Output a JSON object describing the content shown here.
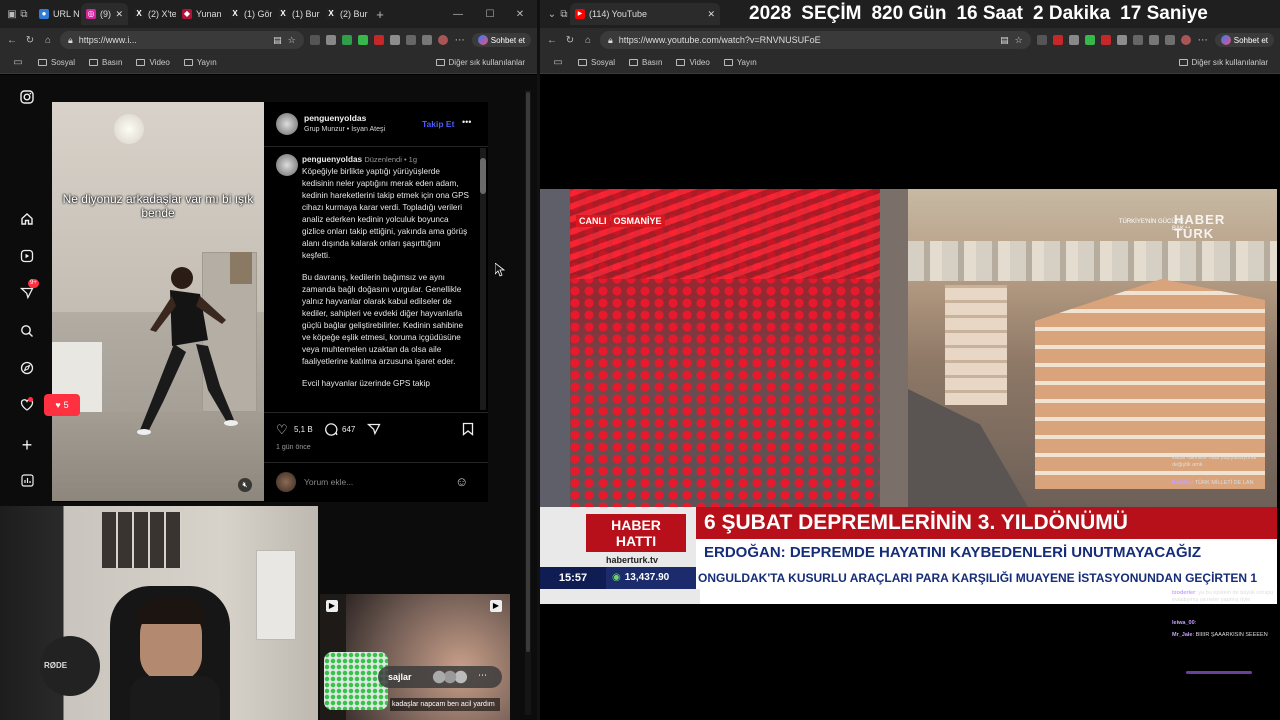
{
  "left_browser": {
    "tabs": [
      {
        "label": "URL Ni",
        "color": "#2f7bd6",
        "glyph": "●"
      },
      {
        "label": "(9)",
        "color": "#d6249f",
        "glyph": "◎"
      },
      {
        "label": "(2) X'te",
        "color": "#222222",
        "glyph": "X"
      },
      {
        "label": "Yunan",
        "color": "#b0123a",
        "glyph": "◆"
      },
      {
        "label": "(1) Gön",
        "color": "#222222",
        "glyph": "X"
      },
      {
        "label": "(1) Burı",
        "color": "#222222",
        "glyph": "X"
      },
      {
        "label": "(2) Burı",
        "color": "#222222",
        "glyph": "X"
      }
    ],
    "url": "https://www.i...",
    "copilot_label": "Sohbet et",
    "bookmarks": [
      "Sosyal",
      "Basın",
      "Video",
      "Yayın"
    ],
    "other_bookmarks": "Diğer sık kullanılanlar"
  },
  "instagram": {
    "video_overlay_text": "Ne diyonuz arkadaşlar var mı bi ışık bende",
    "username": "penguenyoldas",
    "subtitle": "Grup Munzur • İsyan Ateşi",
    "follow_label": "Takip Et",
    "more_label": "•••",
    "caption_user": "penguenyoldas",
    "caption_meta": "Düzenlendi • 1g",
    "caption_p1": "Köpeğiyle birlikte yaptığı yürüyüşlerde kedisinin neler yaptığını merak eden adam, kedinin hareketlerini takip etmek için ona GPS cihazı kurmaya karar verdi. Topladığı verileri analiz ederken kedinin yolculuk boyunca gizlice onları takip ettiğini, yakında ama görüş alanı dışında kalarak onları şaşırttığını keşfetti.",
    "caption_p2": "Bu davranış, kedilerin bağımsız ve aynı zamanda bağlı doğasını vurgular. Genellikle yalnız hayvanlar olarak kabul edilseler de kediler, sahipleri ve evdeki diğer hayvanlarla güçlü bağlar geliştirebilirler. Kedinin sahibine ve köpeğe eşlik etmesi, koruma içgüdüsüne veya muhtemelen uzaktan da olsa aile faaliyetlerine katılma arzusuna işaret eder.",
    "caption_p3": "Evcil hayvanlar üzerinde GPS takip",
    "likes": "5,1 B",
    "comments": "647",
    "time_ago": "1 gün önce",
    "comment_placeholder": "Yorum ekle...",
    "notification_count": "9+",
    "likes_badge": "5",
    "reel_text": "sajlar",
    "reel_subtitle": "kadaşlar napcam ben acil yardım"
  },
  "right_browser": {
    "tab_label": "(114) YouTube",
    "url": "https://www.youtube.com/watch?v=RNVNUSUFoE",
    "copilot_label": "Sohbet et",
    "bookmarks": [
      "Sosyal",
      "Basın",
      "Video",
      "Yayın"
    ],
    "other_bookmarks": "Diğer sık kullanılanlar"
  },
  "countdown": {
    "year": "2028",
    "label": "SEÇİM",
    "days": "820",
    "days_unit": "Gün",
    "hours": "16",
    "hours_unit": "Saat",
    "minutes": "2",
    "minutes_unit": "Dakika",
    "seconds": "17",
    "seconds_unit": "Saniye"
  },
  "broadcast": {
    "live_label": "CANLI",
    "location": "OSMANİYE",
    "channel_logo": "HABER TÜRK",
    "promo_text": "TÜRKİYE'NİN GÜCÜNE BAK",
    "ticker_brand_1": "HABER",
    "ticker_brand_2": "HATTI",
    "site": "haberturk.tv",
    "headline": "6 ŞUBAT DEPREMLERİNİN 3. YILDÖNÜMÜ",
    "subheadline": "ERDOĞAN: DEPREMDE HAYATINI KAYBEDENLERİ UNUTMAYACAĞIZ",
    "clock": "15:57",
    "index_value": "13,437.90",
    "crawl": "ONGULDAK'TA KUSURLU ARAÇLARI PARA KARŞILIĞI MUAYENE İSTASYONUNDAN GEÇİRTEN 1"
  },
  "chat_overlay": [
    {
      "user": "",
      "text": "kadar fakirlikle hala yaşıyabiliyorlar değiştik amk"
    },
    {
      "user": "Kokliliq",
      "text": "TÜRK MİLLETİ DE LAN"
    },
    {
      "user": "tzoderler",
      "text": "ya bu epstein de büyük orospu evladıymış ya neler yapmış öyle"
    },
    {
      "user": "leiwa_00",
      "text": ""
    },
    {
      "user": "Mr_Jale",
      "text": "BIIIIR ŞAAARKISIN SEEEEN"
    }
  ]
}
